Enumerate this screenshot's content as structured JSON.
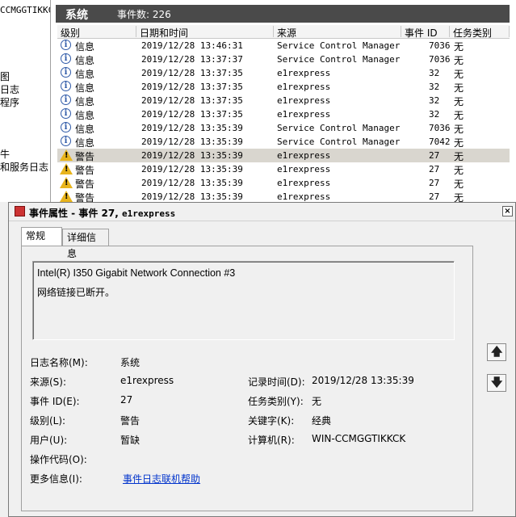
{
  "tree": {
    "host": "CCMGGTIKKC",
    "items": [
      "图",
      "日志",
      "程序",
      "牛",
      "和服务日志"
    ]
  },
  "list": {
    "title": "系统",
    "count_label": "事件数: 226",
    "columns": [
      "级别",
      "日期和时间",
      "来源",
      "事件 ID",
      "任务类别"
    ],
    "rows": [
      {
        "level_icon": "info-icon",
        "level": "信息",
        "datetime": "2019/12/28 13:46:31",
        "source": "Service Control Manager",
        "event_id": "7036",
        "task": "无",
        "selected": false
      },
      {
        "level_icon": "info-icon",
        "level": "信息",
        "datetime": "2019/12/28 13:37:37",
        "source": "Service Control Manager",
        "event_id": "7036",
        "task": "无",
        "selected": false
      },
      {
        "level_icon": "info-icon",
        "level": "信息",
        "datetime": "2019/12/28 13:37:35",
        "source": "e1rexpress",
        "event_id": "32",
        "task": "无",
        "selected": false
      },
      {
        "level_icon": "info-icon",
        "level": "信息",
        "datetime": "2019/12/28 13:37:35",
        "source": "e1rexpress",
        "event_id": "32",
        "task": "无",
        "selected": false
      },
      {
        "level_icon": "info-icon",
        "level": "信息",
        "datetime": "2019/12/28 13:37:35",
        "source": "e1rexpress",
        "event_id": "32",
        "task": "无",
        "selected": false
      },
      {
        "level_icon": "info-icon",
        "level": "信息",
        "datetime": "2019/12/28 13:37:35",
        "source": "e1rexpress",
        "event_id": "32",
        "task": "无",
        "selected": false
      },
      {
        "level_icon": "info-icon",
        "level": "信息",
        "datetime": "2019/12/28 13:35:39",
        "source": "Service Control Manager",
        "event_id": "7036",
        "task": "无",
        "selected": false
      },
      {
        "level_icon": "info-icon",
        "level": "信息",
        "datetime": "2019/12/28 13:35:39",
        "source": "Service Control Manager",
        "event_id": "7042",
        "task": "无",
        "selected": false
      },
      {
        "level_icon": "warning-icon",
        "level": "警告",
        "datetime": "2019/12/28 13:35:39",
        "source": "e1rexpress",
        "event_id": "27",
        "task": "无",
        "selected": true
      },
      {
        "level_icon": "warning-icon",
        "level": "警告",
        "datetime": "2019/12/28 13:35:39",
        "source": "e1rexpress",
        "event_id": "27",
        "task": "无",
        "selected": false
      },
      {
        "level_icon": "warning-icon",
        "level": "警告",
        "datetime": "2019/12/28 13:35:39",
        "source": "e1rexpress",
        "event_id": "27",
        "task": "无",
        "selected": false
      },
      {
        "level_icon": "warning-icon",
        "level": "警告",
        "datetime": "2019/12/28 13:35:39",
        "source": "e1rexpress",
        "event_id": "27",
        "task": "无",
        "selected": false
      }
    ]
  },
  "dialog": {
    "title_prefix": "事件属性 - 事件 27,",
    "title_source": "e1rexpress",
    "close_label": "×",
    "tabs": [
      "常规",
      "详细信息"
    ],
    "description_line1": "Intel(R) I350 Gigabit Network Connection #3",
    "description_line2": "网络链接已断开。",
    "fields": {
      "log_name_label": "日志名称(M):",
      "log_name": "系统",
      "source_label": "来源(S):",
      "source": "e1rexpress",
      "logged_label": "记录时间(D):",
      "logged": "2019/12/28 13:35:39",
      "event_id_label": "事件 ID(E):",
      "event_id": "27",
      "task_label": "任务类别(Y):",
      "task": "无",
      "level_label": "级别(L):",
      "level": "警告",
      "keywords_label": "关键字(K):",
      "keywords": "经典",
      "user_label": "用户(U):",
      "user": "暂缺",
      "computer_label": "计算机(R):",
      "computer": "WIN-CCMGGTIKKCK",
      "opcode_label": "操作代码(O):",
      "opcode": "",
      "more_info_label": "更多信息(I):",
      "more_info_link": "事件日志联机帮助"
    },
    "nav_up": "up-arrow-icon",
    "nav_down": "down-arrow-icon"
  }
}
